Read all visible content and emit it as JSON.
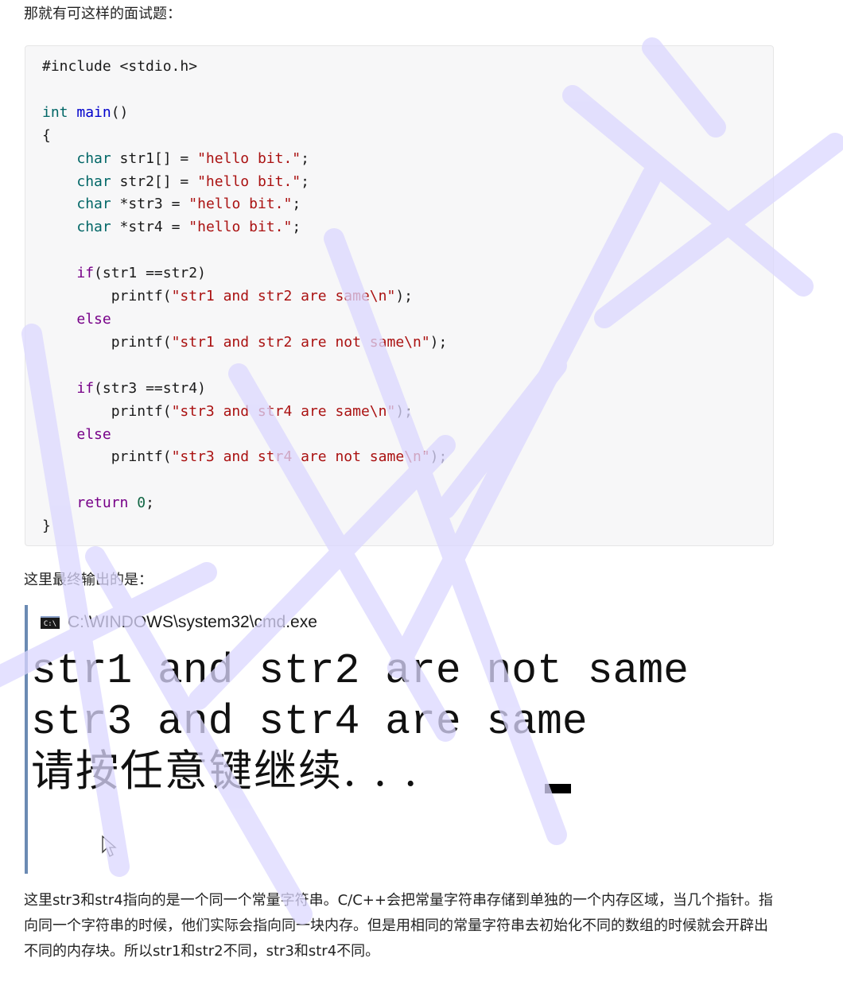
{
  "intro_text": "那就有可这样的面试题：",
  "code": {
    "lines": [
      "#include <stdio.h>",
      "",
      "int main()",
      "{",
      "    char str1[] = \"hello bit.\";",
      "    char str2[] = \"hello bit.\";",
      "    char *str3 = \"hello bit.\";",
      "    char *str4 = \"hello bit.\";",
      "",
      "    if(str1 ==str2)",
      "        printf(\"str1 and str2 are same\\n\");",
      "    else",
      "        printf(\"str1 and str2 are not same\\n\");",
      "",
      "    if(str3 ==str4)",
      "        printf(\"str3 and str4 are same\\n\");",
      "    else",
      "        printf(\"str3 and str4 are not same\\n\");",
      "",
      "    return 0;",
      "}"
    ]
  },
  "output_intro": "这里最终输出的是：",
  "console": {
    "icon_label": "C:\\",
    "title": "C:\\WINDOWS\\system32\\cmd.exe",
    "lines": [
      "str1 and str2 are not same",
      "str3 and str4 are same",
      "请按任意键继续. . ."
    ]
  },
  "explanation": "这里str3和str4指向的是一个同一个常量字符串。C/C++会把常量字符串存储到单独的一个内存区域，当几个指针。指向同一个字符串的时候，他们实际会指向同一块内存。但是用相同的常量字符串去初始化不同的数组的时候就会开辟出不同的内存块。所以str1和str2不同，str3和str4不同。",
  "colors": {
    "keyword_type": "#006666",
    "keyword": "#770088",
    "string": "#aa1111",
    "function": "#0000cc",
    "number": "#116644",
    "watermark": "#dcd8ff"
  }
}
